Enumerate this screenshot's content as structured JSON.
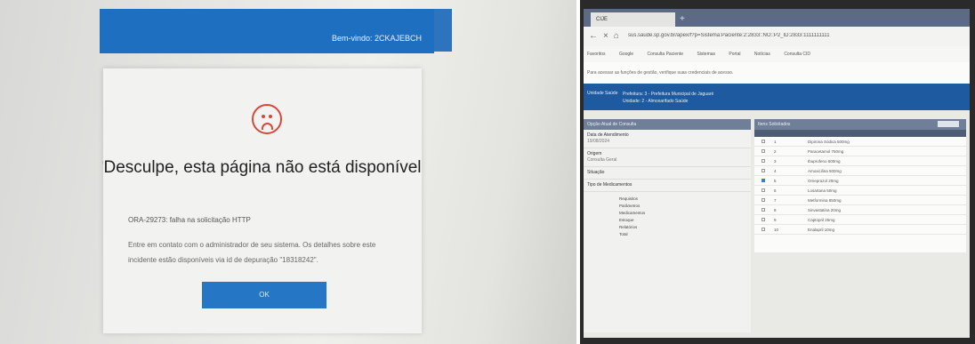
{
  "left": {
    "topbar_text": "Bem-vindo: 2CKAJEBCH",
    "dialog": {
      "title": "Desculpe, esta página não está disponível",
      "error": "ORA-29273: falha na solicitação HTTP",
      "message": "Entre em contato com o administrador de seu sistema. Os detalhes sobre este incidente estão disponíveis via id de depuração \"18318242\".",
      "ok_label": "OK",
      "icon": "sad-face-icon"
    }
  },
  "right": {
    "tab_label": "CIJE",
    "url": "sus.saude.sp.gov.br/apex/f?p=Sistema:Paciente:2:2833::NO::P2_ID:2833:1111111111",
    "bookmarks": [
      "Favoritos",
      "Google",
      "Consulta Paciente",
      "Sistemas",
      "Portal",
      "Notícias",
      "Consulta CID"
    ],
    "infobar": "Para acessar as funções de gestão, verifique suas credenciais de acesso.",
    "header": {
      "title": "Unidade Saúde",
      "line1": "Prefeitura: 3 - Prefeitura Municipal de Jaguaré",
      "line2": "Unidade: 2 - Almoxarifado Saúde"
    },
    "left_panel": {
      "title": "Opção Atual de Consulta",
      "items": [
        {
          "label": "Data de Atendimento",
          "sub": "19/08/2024"
        },
        {
          "label": "Origem",
          "sub": "Consulta Geral"
        },
        {
          "label": "Situação",
          "sub": ""
        },
        {
          "label": "Tipo de Medicamentos",
          "sub": ""
        }
      ],
      "tree": [
        "Requisitos",
        "Parâmetros",
        "Medicamentos",
        "Estoque",
        "Relatórios",
        "Total"
      ]
    },
    "right_panel": {
      "title": "Itens Solicitados",
      "rows": [
        {
          "num": "1",
          "desc": "Dipirona Sódica 500mg"
        },
        {
          "num": "2",
          "desc": "Paracetamol 750mg"
        },
        {
          "num": "3",
          "desc": "Ibuprofeno 600mg"
        },
        {
          "num": "4",
          "desc": "Amoxicilina 500mg"
        },
        {
          "num": "5",
          "desc": "Omeprazol 20mg"
        },
        {
          "num": "6",
          "desc": "Losartana 50mg"
        },
        {
          "num": "7",
          "desc": "Metformina 850mg"
        },
        {
          "num": "8",
          "desc": "Sinvastatina 20mg"
        },
        {
          "num": "9",
          "desc": "Captopril 25mg"
        },
        {
          "num": "10",
          "desc": "Enalapril 10mg"
        }
      ]
    }
  }
}
